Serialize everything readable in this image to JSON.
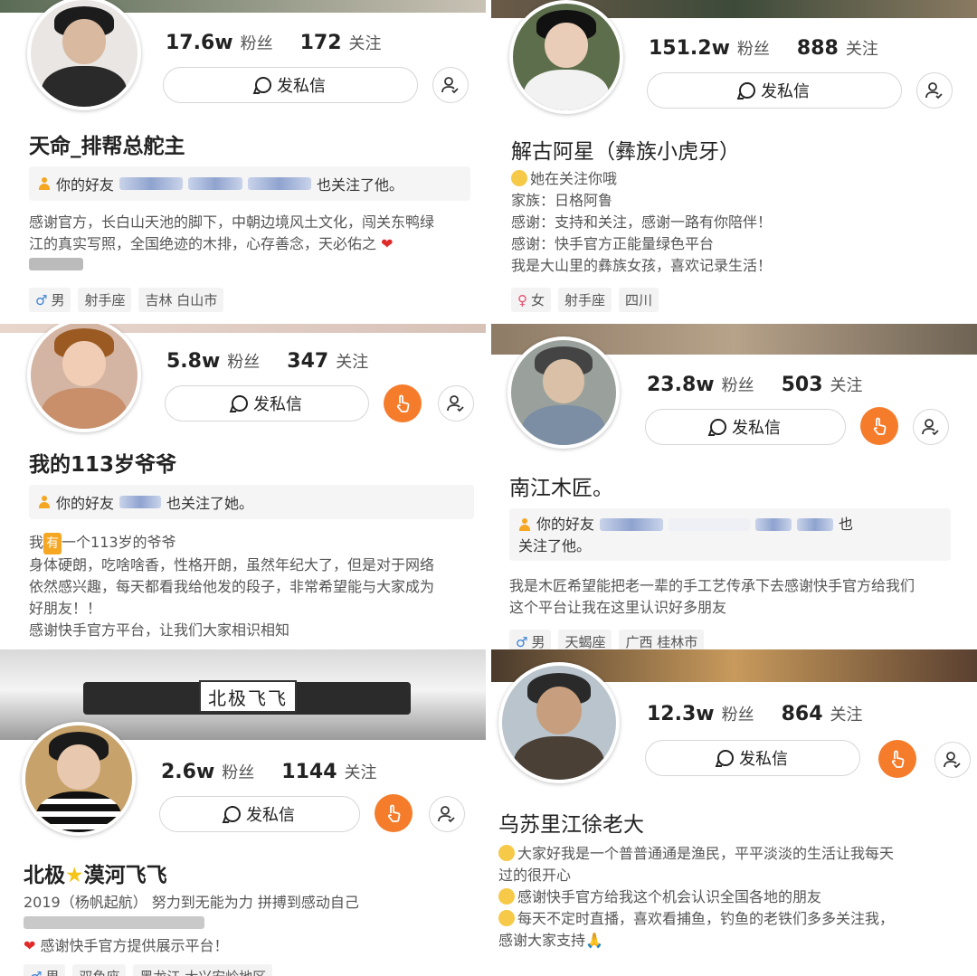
{
  "dm_label": "发私信",
  "fans_unit": "粉丝",
  "follow_unit": "关注",
  "accent_color": "#f57c2b",
  "profiles": [
    {
      "fans": "17.6w",
      "follows": "172",
      "name": "天命_排帮总舵主",
      "friend_prefix": "你的好友",
      "friend_suffix": "也关注了他。",
      "bio": [
        "感谢官方，长白山天池的脚下，中朝边境风土文化，闯关东鸭绿",
        "江的真实写照，全国绝迹的木排，心存善念，天必佑之"
      ],
      "tags": [
        "男",
        "射手座",
        "吉林 白山市"
      ]
    },
    {
      "fans": "151.2w",
      "follows": "888",
      "name": "解古阿星（彝族小虎牙）",
      "follow_note": "她在关注你哦",
      "bio": [
        "家族：日格阿鲁",
        "感谢：支持和关注，感谢一路有你陪伴！",
        "感谢：快手官方正能量绿色平台",
        "我是大山里的彝族女孩，喜欢记录生活！"
      ],
      "tags": [
        "女",
        "射手座",
        "四川"
      ]
    },
    {
      "fans": "5.8w",
      "follows": "347",
      "name": "我的113岁爷爷",
      "friend_prefix": "你的好友",
      "friend_suffix": "也关注了她。",
      "bio_first_pre": "我",
      "bio_first_hl": "有",
      "bio_first_post": "一个113岁的爷爷",
      "bio": [
        "身体硬朗，吃啥啥香，性格开朗，虽然年纪大了，但是对于网络",
        "依然感兴趣，每天都看我给他发的段子，非常希望能与大家成为",
        "好朋友！！",
        "感谢快手官方平台，让我们大家相识相知"
      ]
    },
    {
      "fans": "23.8w",
      "follows": "503",
      "name": "南江木匠。",
      "friend_prefix": "你的好友",
      "friend_suffix_1": "也",
      "friend_suffix_2": "关注了他。",
      "bio": [
        "我是木匠希望能把老一辈的手工艺传承下去感谢快手官方给我们",
        "这个平台让我在这里认识好多朋友"
      ],
      "tags": [
        "男",
        "天蝎座",
        "广西 桂林市"
      ]
    },
    {
      "fans": "2.6w",
      "follows": "1144",
      "plate": "北极飞飞",
      "name_pre": "北极",
      "name_post": "漠河飞飞",
      "bio_line1": "2019（杨帆起航）  努力到无能为力  拼搏到感动自己",
      "bio_line3": "感谢快手官方提供展示平台！",
      "tags": [
        "男",
        "双鱼座",
        "黑龙江 大兴安岭地区"
      ]
    },
    {
      "fans": "12.3w",
      "follows": "864",
      "name": "乌苏里江徐老大",
      "bio": [
        "大家好我是一个普普通通是渔民，平平淡淡的生活让我每天",
        "过的很开心",
        "感谢快手官方给我这个机会认识全国各地的朋友",
        "每天不定时直播，喜欢看捕鱼，钓鱼的老铁们多多关注我，",
        "感谢大家支持"
      ]
    }
  ]
}
